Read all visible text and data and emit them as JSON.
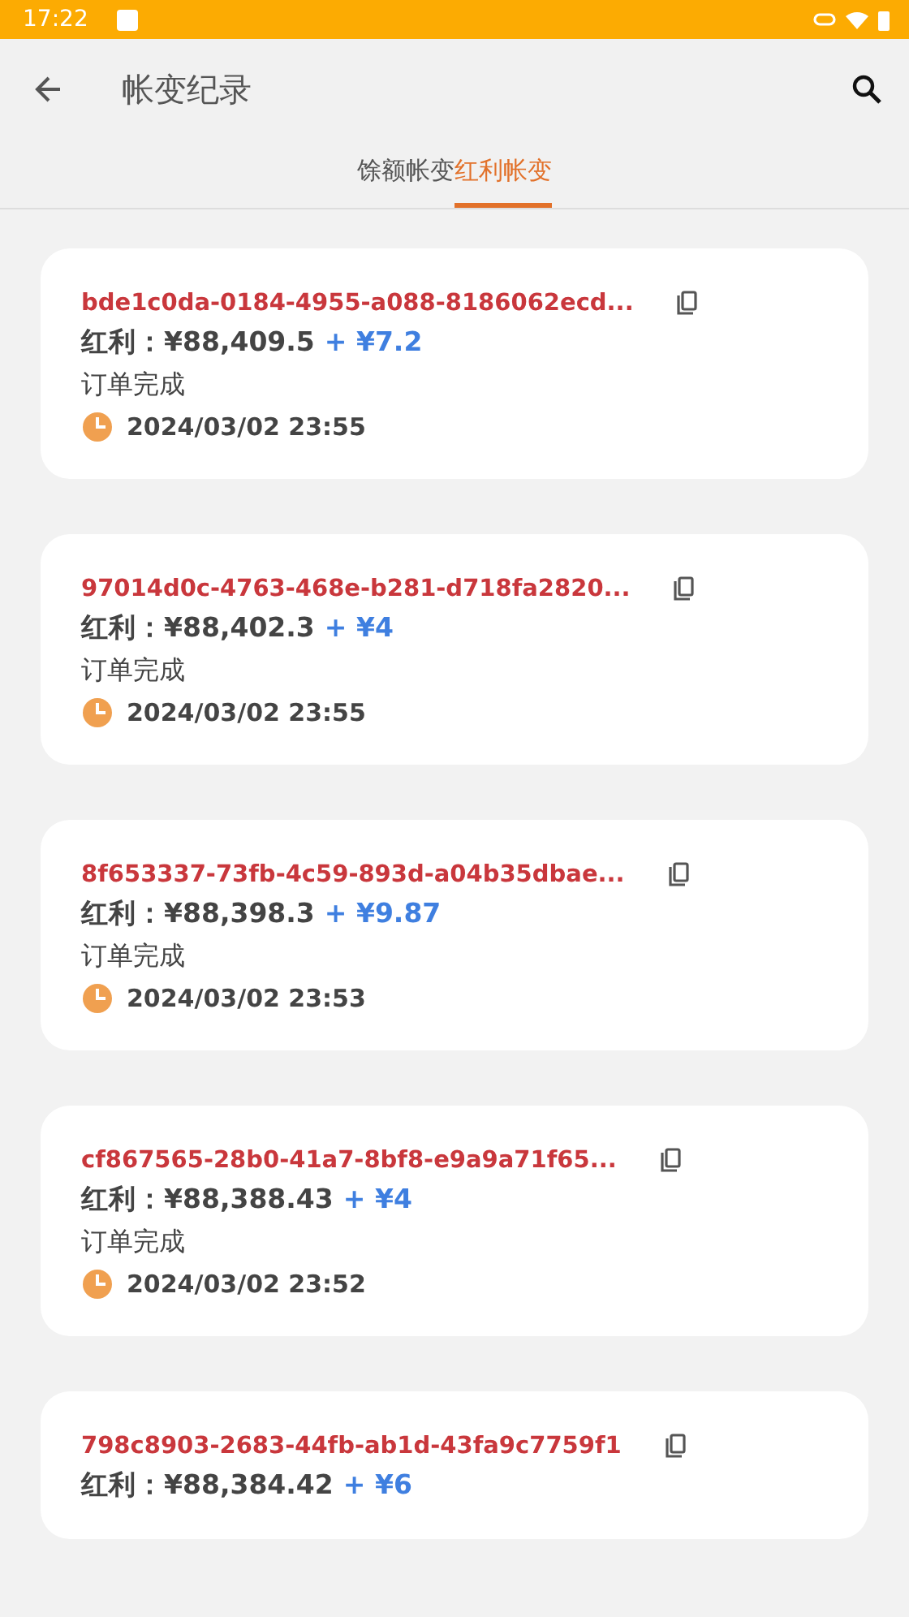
{
  "status_bar": {
    "time": "17:22"
  },
  "header": {
    "title": "帐变纪录"
  },
  "tabs": [
    {
      "label": "馀额帐变",
      "selected": false
    },
    {
      "label": "红利帐变",
      "selected": true
    }
  ],
  "records": [
    {
      "id": "bde1c0da-0184-4955-a088-8186062ecd...",
      "balance": "红利：¥88,409.5",
      "change": "+ ¥7.2",
      "status": "订单完成",
      "time": "2024/03/02 23:55"
    },
    {
      "id": "97014d0c-4763-468e-b281-d718fa2820...",
      "balance": "红利：¥88,402.3",
      "change": "+ ¥4",
      "status": "订单完成",
      "time": "2024/03/02 23:55"
    },
    {
      "id": "8f653337-73fb-4c59-893d-a04b35dbae...",
      "balance": "红利：¥88,398.3",
      "change": "+ ¥9.87",
      "status": "订单完成",
      "time": "2024/03/02 23:53"
    },
    {
      "id": "cf867565-28b0-41a7-8bf8-e9a9a71f65...",
      "balance": "红利：¥88,388.43",
      "change": "+ ¥4",
      "status": "订单完成",
      "time": "2024/03/02 23:52"
    },
    {
      "id": "798c8903-2683-44fb-ab1d-43fa9c7759f1",
      "balance": "红利：¥88,384.42",
      "change": "+ ¥6"
    }
  ]
}
